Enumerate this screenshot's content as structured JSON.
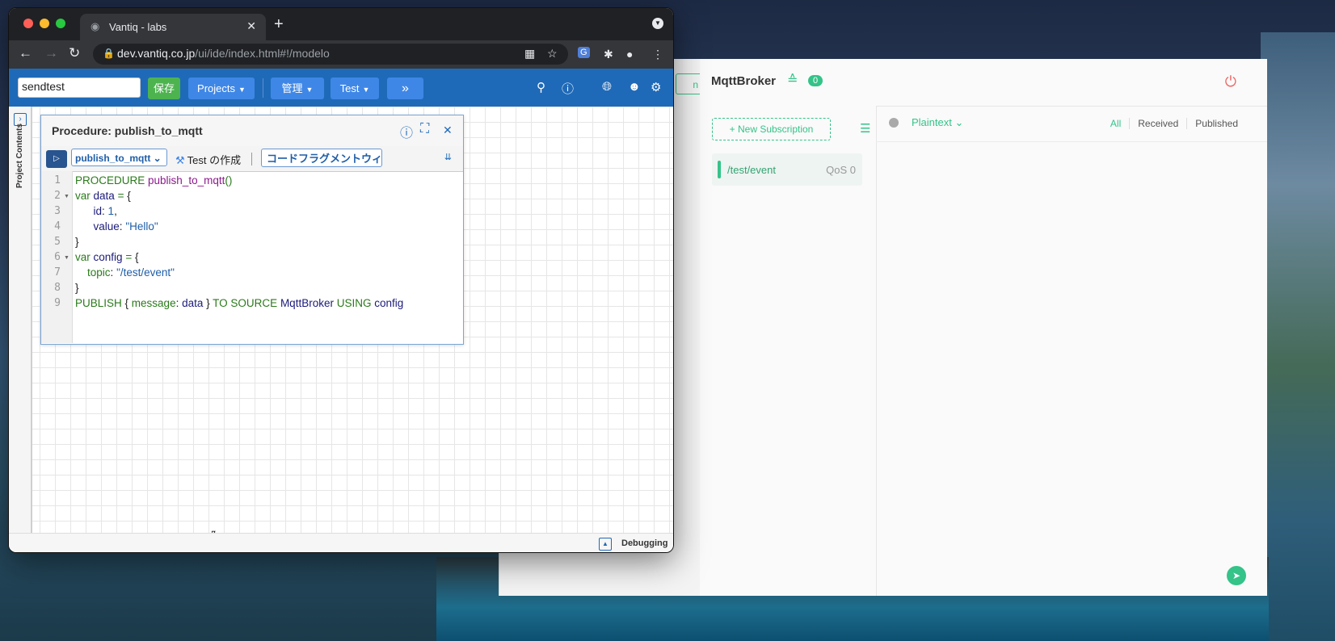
{
  "browser": {
    "tab_title": "Vantiq - labs",
    "url_domain": "dev.vantiq.co.jp",
    "url_path": "/ui/ide/index.html#!/modelo"
  },
  "vantiq": {
    "namespace_input": "sendtest",
    "save_label": "保存",
    "projects_label": "Projects",
    "admin_label": "管理",
    "test_label": "Test",
    "more_label": "»",
    "side_label": "Project Contents",
    "debugging_label": "Debugging"
  },
  "procedure": {
    "title": "Procedure: publish_to_mqtt",
    "selector": "publish_to_mqtt",
    "test_create": "Test の作成",
    "fragment": "コードフラグメントウィ",
    "lines": [
      "1",
      "2",
      "3",
      "4",
      "5",
      "6",
      "7",
      "8",
      "9"
    ]
  },
  "mqtt": {
    "stub_label": "n",
    "connection_name": "MqttBroker",
    "badge": "0",
    "new_subscription": "New Subscription",
    "sub_topic": "/test/event",
    "sub_qos": "QoS 0",
    "format": "Plaintext",
    "tabs": [
      "All",
      "Received",
      "Published"
    ]
  },
  "colors": {
    "vantiq_blue": "#1f6ab8",
    "mqtt_green": "#34c388"
  }
}
